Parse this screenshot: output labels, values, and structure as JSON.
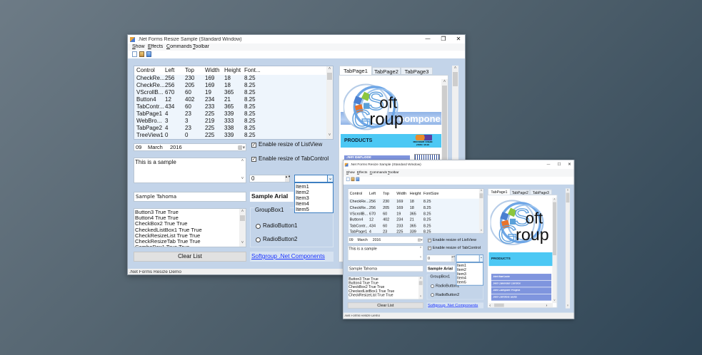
{
  "colors": {
    "client": "#c3d4e9",
    "link": "#1a33ff",
    "products_bar": "#4cc8f4",
    "product_item": "#7f95de",
    "accent_border": "#3d7fc1"
  },
  "windows": [
    {
      "title": ".Net Forms Resize Sample (Standard Window)",
      "title_buttons": {
        "minimize": "—",
        "maximize": "❐",
        "close": "✕"
      },
      "menu": [
        "Show",
        "Effects",
        "Commands",
        "Toolbar"
      ],
      "toolbar_icons": [
        "new-document-icon",
        "picture-icon",
        "clipboard-icon"
      ],
      "listview": {
        "headers": [
          "Control",
          "Left",
          "Top",
          "Width",
          "Height",
          "Font..."
        ],
        "rows": [
          [
            "CheckRe...",
            "256",
            "230",
            "169",
            "18",
            "8.25"
          ],
          [
            "CheckRe...",
            "256",
            "205",
            "169",
            "18",
            "8.25"
          ],
          [
            "VScrollB...",
            "670",
            "60",
            "19",
            "365",
            "8.25"
          ],
          [
            "Button4",
            "12",
            "402",
            "234",
            "21",
            "8.25"
          ],
          [
            "TabContr...",
            "434",
            "60",
            "233",
            "365",
            "8.25"
          ],
          [
            "TabPage1",
            "4",
            "23",
            "225",
            "339",
            "8.25"
          ],
          [
            "WebBro...",
            "3",
            "3",
            "219",
            "333",
            "8.25"
          ],
          [
            "TabPage2",
            "4",
            "23",
            "225",
            "338",
            "8.25"
          ],
          [
            "TreeView1",
            "0",
            "0",
            "225",
            "339",
            "8.25"
          ]
        ]
      },
      "date": {
        "day": "09",
        "month": "March",
        "year": "2016"
      },
      "checkboxes": [
        {
          "label": "Enable resize of ListView",
          "checked": true
        },
        {
          "label": "Enable resize of TabControl",
          "checked": true
        }
      ],
      "memo": "This is a sample",
      "numeric": "0",
      "combo": {
        "value": "",
        "items": [
          "Item1",
          "Item2",
          "Item3",
          "Item4",
          "Item5"
        ]
      },
      "tahoma_text": "Sample Tahoma",
      "arial_label": "Sample Arial",
      "listbox": [
        "Button3 True True",
        "Button4 True True",
        "CheckBox2 True True",
        "CheckedListBox1 True True",
        "CheckResizeList True True",
        "CheckResizeTab True True",
        "ComboBox1 True True"
      ],
      "groupbox": {
        "title": "GroupBox1",
        "radios": [
          "RadioButton1",
          "RadioButton2"
        ]
      },
      "clear_button": "Clear List",
      "link": "Softgroup .Net Components",
      "tabs": [
        "TabPage1",
        "TabPage2",
        "TabPage3"
      ],
      "browser": {
        "logo": "SoftGroup",
        "band_text": "compone",
        "products": "PRODUCTS",
        "badge": [
          "Microsoft Visual",
          "2008 / 2010"
        ],
        "items": [
          ".Net BarCode"
        ]
      },
      "status": ".Net Forms Resize Demo"
    },
    {
      "title": ".Net Forms Resize Sample (Standard Window)",
      "title_buttons": {
        "minimize": "—",
        "maximize": "☐",
        "close": "✕"
      },
      "menu": [
        "Show",
        "Effects",
        "Commands",
        "Toolbar"
      ],
      "toolbar_icons": [
        "new-document-icon",
        "picture-icon",
        "clipboard-icon"
      ],
      "listview": {
        "headers": [
          "Control",
          "Left",
          "Top",
          "Width",
          "Height",
          "FontSize"
        ],
        "rows": [
          [
            "CheckRe...",
            "256",
            "230",
            "169",
            "18",
            "8.25"
          ],
          [
            "CheckRe...",
            "256",
            "205",
            "169",
            "18",
            "8.25"
          ],
          [
            "VScrollB...",
            "670",
            "60",
            "19",
            "365",
            "8.25"
          ],
          [
            "Button4",
            "12",
            "402",
            "234",
            "21",
            "8.25"
          ],
          [
            "TabContr...",
            "434",
            "60",
            "233",
            "365",
            "8.25"
          ],
          [
            "TabPage1",
            "4",
            "23",
            "225",
            "339",
            "8.25"
          ]
        ]
      },
      "date": {
        "day": "09",
        "month": "March",
        "year": "2016"
      },
      "checkboxes": [
        {
          "label": "Enable resize of ListView",
          "checked": true
        },
        {
          "label": "Enable resize of TabControl",
          "checked": true
        }
      ],
      "memo": "This is a sample",
      "numeric": "0",
      "combo": {
        "value": "",
        "items": [
          "Item1",
          "Item2",
          "Item3",
          "Item4",
          "Item5"
        ]
      },
      "tahoma_text": "Sample Tahoma",
      "arial_label": "Sample Arial",
      "listbox": [
        "Button3 True True",
        "Button4 True True",
        "CheckBox2 True True",
        "CheckedListBox1 True True",
        "CheckResizeList True True"
      ],
      "groupbox": {
        "title": "GroupBox1",
        "radios": [
          "RadioButton1",
          "RadioButton2"
        ]
      },
      "clear_button": "Clear List",
      "link": "Softgroup .Net Components",
      "tabs": [
        "TabPage1",
        "TabPage2",
        "TabPage3"
      ],
      "browser": {
        "logo": "SoftGroup",
        "band_text": "",
        "products": "PRODUCTS",
        "items": [
          ".Net BarCode",
          ".Net Calendar Control",
          ".Net Compiler Project",
          ".Net Controls Suite"
        ]
      },
      "status": ".Net Forms Resize Demo"
    }
  ]
}
